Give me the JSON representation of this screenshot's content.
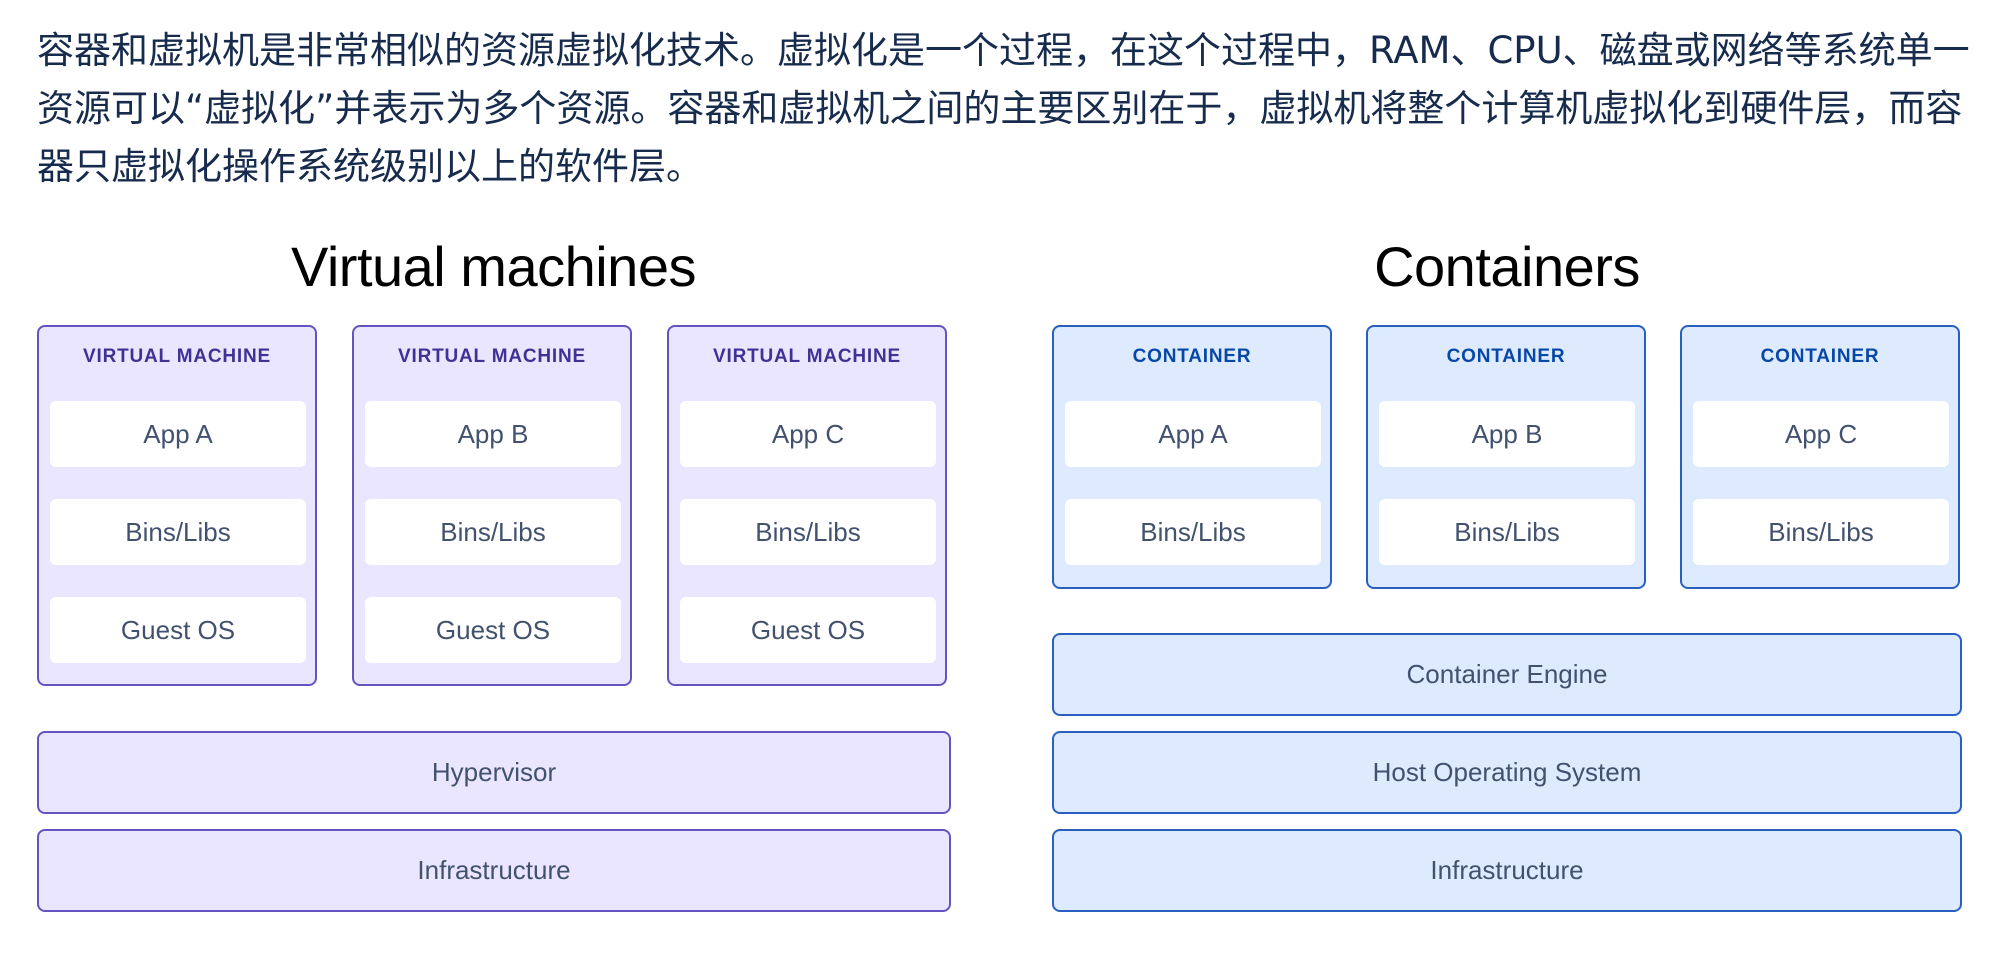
{
  "intro_text": "容器和虚拟机是非常相似的资源虚拟化技术。虚拟化是一个过程，在这个过程中，RAM、CPU、磁盘或网络等系统单一资源可以“虚拟化”并表示为多个资源。容器和虚拟机之间的主要区别在于，虚拟机将整个计算机虚拟化到硬件层，而容器只虚拟化操作系统级别以上的软件层。",
  "vm": {
    "title": "Virtual machines",
    "columns": [
      {
        "label": "VIRTUAL MACHINE",
        "app": "App A",
        "libs": "Bins/Libs",
        "os": "Guest OS"
      },
      {
        "label": "VIRTUAL MACHINE",
        "app": "App B",
        "libs": "Bins/Libs",
        "os": "Guest OS"
      },
      {
        "label": "VIRTUAL MACHINE",
        "app": "App C",
        "libs": "Bins/Libs",
        "os": "Guest OS"
      }
    ],
    "layers": [
      "Hypervisor",
      "Infrastructure"
    ]
  },
  "containers": {
    "title": "Containers",
    "columns": [
      {
        "label": "CONTAINER",
        "app": "App A",
        "libs": "Bins/Libs"
      },
      {
        "label": "CONTAINER",
        "app": "App B",
        "libs": "Bins/Libs"
      },
      {
        "label": "CONTAINER",
        "app": "App C",
        "libs": "Bins/Libs"
      }
    ],
    "layers": [
      "Container Engine",
      "Host Operating System",
      "Infrastructure"
    ]
  },
  "colors": {
    "vm_fill": "#eae6ff",
    "vm_border": "#6554c0",
    "vm_label": "#403294",
    "container_fill": "#deebff",
    "container_border": "#2a5fc2",
    "container_label": "#0747a6",
    "box_text": "#42526e"
  }
}
